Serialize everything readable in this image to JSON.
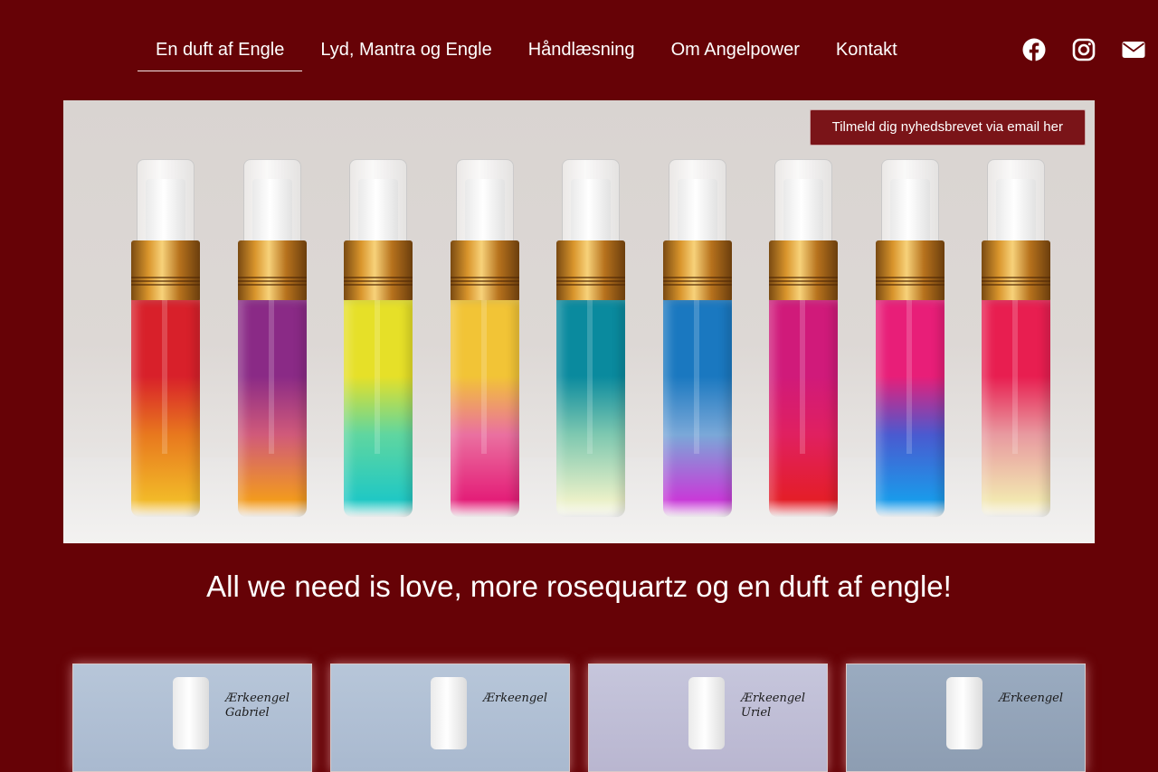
{
  "nav": {
    "items": [
      {
        "label": "En duft af Engle",
        "active": true
      },
      {
        "label": "Lyd, Mantra og Engle",
        "active": false
      },
      {
        "label": "Håndlæsning",
        "active": false
      },
      {
        "label": "Om Angelpower",
        "active": false
      },
      {
        "label": "Kontakt",
        "active": false
      }
    ]
  },
  "social": {
    "icons": [
      "facebook-icon",
      "instagram-icon",
      "envelope-icon"
    ]
  },
  "hero": {
    "newsletter_label": "Tilmeld dig nyhedsbrevet via email her",
    "bottle_gradients": [
      [
        "#d8202a",
        "#e8781e",
        "#f2b928"
      ],
      [
        "#8a2a86",
        "#d05a7a",
        "#f29a1e"
      ],
      [
        "#e6e028",
        "#5fd6a0",
        "#20c8c4"
      ],
      [
        "#f2c436",
        "#ea70a0",
        "#e41e78"
      ],
      [
        "#0a8a9e",
        "#7ec8b0",
        "#eaf0c8"
      ],
      [
        "#1a78c0",
        "#7aa8d8",
        "#c83ad8"
      ],
      [
        "#d01a7a",
        "#e02060",
        "#e41e28"
      ],
      [
        "#e81e78",
        "#4a5ad0",
        "#1a9aea"
      ],
      [
        "#e81e50",
        "#e89aa0",
        "#f2e6b0"
      ]
    ]
  },
  "tagline": "All we need is love, more rosequartz og en duft af engle!",
  "cards": [
    {
      "label": "Ærkeengel Gabriel"
    },
    {
      "label": "Ærkeengel"
    },
    {
      "label": "Ærkeengel Uriel"
    },
    {
      "label": "Ærkeengel"
    }
  ]
}
